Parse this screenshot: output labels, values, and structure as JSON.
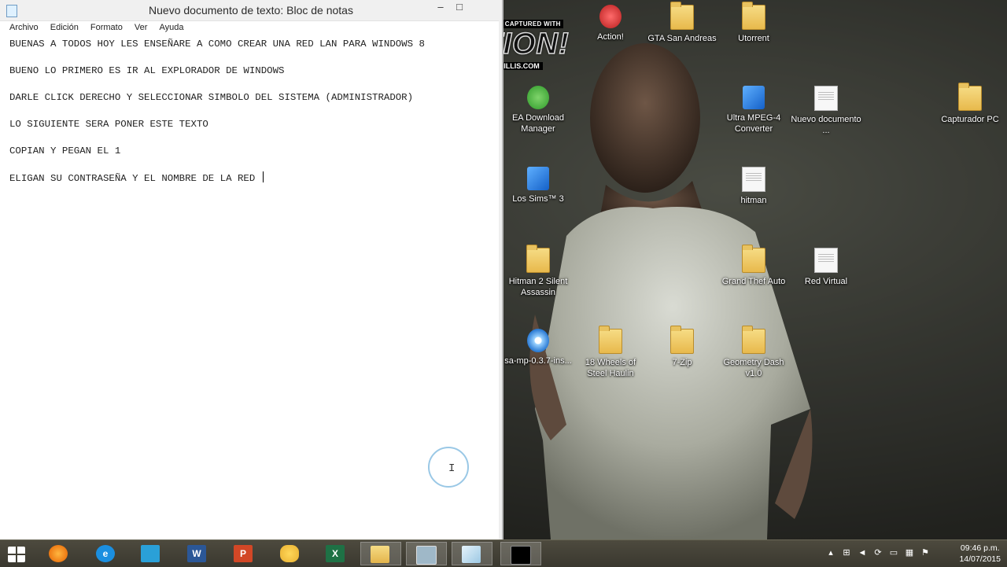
{
  "window": {
    "title": "Nuevo documento de texto: Bloc de notas",
    "minimize_glyph": "–",
    "maximize_glyph": "□"
  },
  "menu": [
    "Archivo",
    "Edición",
    "Formato",
    "Ver",
    "Ayuda"
  ],
  "document_lines": [
    "BUENAS A TODOS HOY LES ENSEÑARE A COMO CREAR UNA RED LAN PARA WINDOWS 8",
    "",
    "BUENO LO PRIMERO ES IR AL EXPLORADOR DE WINDOWS",
    "",
    "DARLE CLICK DERECHO Y SELECCIONAR SIMBOLO DEL SISTEMA (ADMINISTRADOR)",
    "",
    "LO SIGUIENTE SERA PONER ESTE TEXTO",
    "",
    "COPIAN Y PEGAN EL 1",
    "",
    "ELIGAN SU CONTRASEÑA Y EL NOMBRE DE LA RED "
  ],
  "watermark": {
    "top": "THIS VIDEO WAS CAPTURED WITH",
    "brand": "ACTION!",
    "url": "WWW.MIRILLIS.COM"
  },
  "desktop_icons": {
    "action": "Action!",
    "gta": "GTA San Andreas",
    "utorrent": "Utorrent",
    "ea": "EA Download Manager",
    "ultra": "Ultra MPEG-4 Converter",
    "nuevo": "Nuevo documento ...",
    "capturador": "Capturador PC",
    "sims": "Los Sims™ 3",
    "hitman": "hitman",
    "hitman2": "Hitman 2 Silent Assassin",
    "grand": "Grand Thef Auto",
    "redvirtual": "Red Virtual",
    "samp": "sa-mp-0.3.7-ins...",
    "wheels": "18 Wheels of Steel Haulin",
    "zip": "7-Zip",
    "geometry": "Geometry Dash v1.0"
  },
  "taskbar": {
    "apps": [
      {
        "name": "firefox",
        "icon": "firefox-icon",
        "color": "#e66000"
      },
      {
        "name": "internet-explorer",
        "icon": "ie-icon",
        "color": "#1b8fe0"
      },
      {
        "name": "desktop-app",
        "icon": "monitor-icon",
        "color": "#2aa0d8"
      },
      {
        "name": "word",
        "icon": "word-icon",
        "color": "#2b5797",
        "letter": "W"
      },
      {
        "name": "powerpoint",
        "icon": "powerpoint-icon",
        "color": "#d24726",
        "letter": "P"
      },
      {
        "name": "paint",
        "icon": "paint-icon",
        "color": "#e9b030"
      },
      {
        "name": "excel",
        "icon": "excel-icon",
        "color": "#1e7145",
        "letter": "X"
      },
      {
        "name": "file-explorer",
        "icon": "folder-icon",
        "color": "#e8c25f"
      },
      {
        "name": "window-app",
        "icon": "window-icon",
        "color": "#9fb8c8"
      },
      {
        "name": "notepad",
        "icon": "notepad-icon",
        "color": "#b9d7ea"
      },
      {
        "name": "cmd",
        "icon": "cmd-icon",
        "color": "#000000"
      }
    ],
    "time": "09:46 p.m.",
    "date": "14/07/2015"
  }
}
